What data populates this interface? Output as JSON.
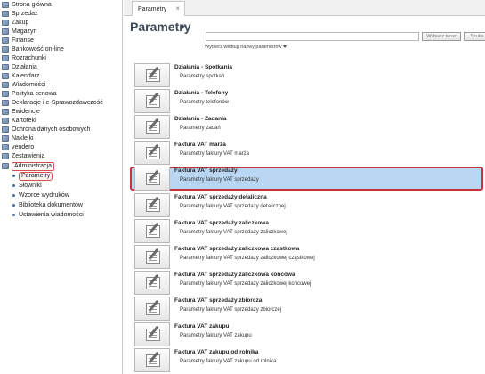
{
  "sidebar": {
    "items": [
      {
        "label": "Strona główna"
      },
      {
        "label": "Sprzedaż"
      },
      {
        "label": "Zakup"
      },
      {
        "label": "Magazyn"
      },
      {
        "label": "Finanse"
      },
      {
        "label": "Bankowość on-line"
      },
      {
        "label": "Rozrachunki"
      },
      {
        "label": "Działania"
      },
      {
        "label": "Kalendarz"
      },
      {
        "label": "Wiadomości"
      },
      {
        "label": "Polityka cenowa"
      },
      {
        "label": "Deklaracje i e-Sprawozdawczość"
      },
      {
        "label": "Ewidencje"
      },
      {
        "label": "Kartoteki"
      },
      {
        "label": "Ochrona danych osobowych"
      },
      {
        "label": "Naklejki"
      },
      {
        "label": "vendero"
      },
      {
        "label": "Zestawienia"
      },
      {
        "label": "Administracja"
      }
    ],
    "subitems": [
      {
        "label": "Parametry"
      },
      {
        "label": "Słowniki"
      },
      {
        "label": "Wzorce wydruków"
      },
      {
        "label": "Biblioteka dokumentów"
      },
      {
        "label": "Ustawienia wiadomości"
      }
    ]
  },
  "tabs": [
    {
      "label": "Parametry",
      "close": "×"
    }
  ],
  "header": {
    "title": "Parametry",
    "search_placeholder": "",
    "search_button": "Wybierz teraz",
    "search_button_2": "Szuka",
    "search_mode": "Wybierz według nazwy parametrów"
  },
  "list": [
    {
      "title": "Działania - Spotkania",
      "desc": "Parametry spotkań"
    },
    {
      "title": "Działania - Telefony",
      "desc": "Parametry telefonów"
    },
    {
      "title": "Działania - Zadania",
      "desc": "Parametry zadań"
    },
    {
      "title": "Faktura VAT marża",
      "desc": "Parametry faktury VAT marża"
    },
    {
      "title": "Faktura VAT sprzedaży",
      "desc": "Parametry faktury VAT sprzedaży"
    },
    {
      "title": "Faktura VAT sprzedaży detaliczna",
      "desc": "Parametry faktury VAT sprzedaży detalicznej"
    },
    {
      "title": "Faktura VAT sprzedaży zaliczkowa",
      "desc": "Parametry faktury VAT sprzedaży zaliczkowej"
    },
    {
      "title": "Faktura VAT sprzedaży zaliczkowa cząstkowa",
      "desc": "Parametry faktury VAT sprzedaży zaliczkowej cząstkowej"
    },
    {
      "title": "Faktura VAT sprzedaży zaliczkowa końcowa",
      "desc": "Parametry faktury VAT sprzedaży zaliczkowej końcowej"
    },
    {
      "title": "Faktura VAT sprzedaży zbiorcza",
      "desc": "Parametry faktury VAT sprzedaży zbiorczej"
    },
    {
      "title": "Faktura VAT zakupu",
      "desc": "Parametry faktury VAT zakupu"
    },
    {
      "title": "Faktura VAT zakupu od rolnika",
      "desc": "Parametry faktury VAT zakupu od rolnika"
    }
  ],
  "colors": {
    "selection_fill": "#b9d7f2",
    "selection_border": "#c8323c",
    "active_marker": "#d94c4c"
  }
}
